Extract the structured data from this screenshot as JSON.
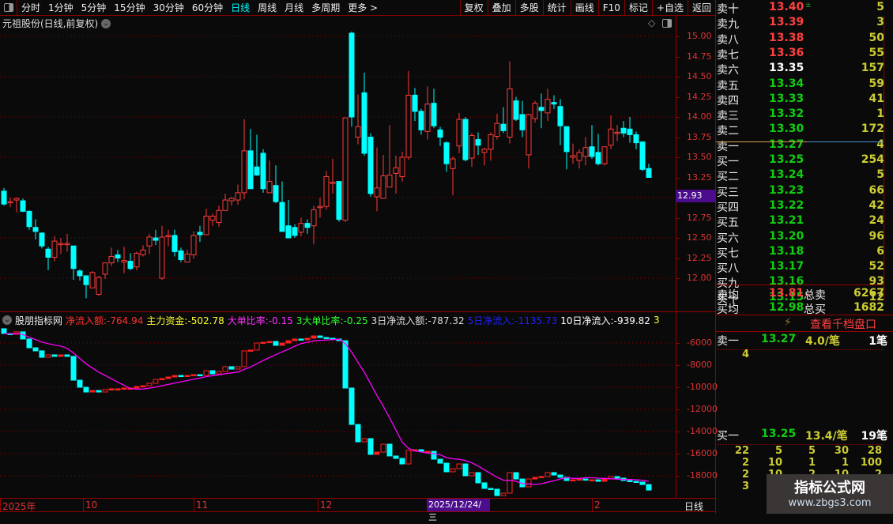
{
  "toolbar": {
    "periods": [
      "分时",
      "1分钟",
      "5分钟",
      "15分钟",
      "30分钟",
      "60分钟",
      "日线",
      "周线",
      "月线",
      "多周期",
      "更多 >"
    ],
    "active": "日线",
    "buttons": [
      "复权",
      "叠加",
      "多股",
      "统计",
      "画线",
      "F10",
      "标记",
      "+自选",
      "返回"
    ]
  },
  "stock_title": "元祖股份(日线,前复权)",
  "price_axis": {
    "labels": [
      "15.00",
      "14.75",
      "14.50",
      "14.25",
      "14.00",
      "13.75",
      "13.50",
      "13.25",
      "13.00",
      "12.75",
      "12.50",
      "12.25",
      "12.00"
    ],
    "cursor_price": "12.93"
  },
  "indicator": {
    "name": "股朋指标网",
    "items": [
      {
        "label": "净流入额:",
        "value": "-764.94",
        "color": "#ff3030"
      },
      {
        "label": "主力资金:",
        "value": "-502.78",
        "color": "#ffff30"
      },
      {
        "label": "大单比率:",
        "value": "-0.15",
        "color": "#ff30ff"
      },
      {
        "label": "3大单比率:",
        "value": "-0.25",
        "color": "#30ff30"
      },
      {
        "label": "3日净流入额:",
        "value": "-787.32",
        "color": "#dddddd"
      },
      {
        "label": "5日净流入:",
        "value": "-1135.73",
        "color": "#2020ff"
      },
      {
        "label": "10日净流入:",
        "value": "-939.82",
        "color": "#ffffff"
      },
      {
        "label": "3",
        "value": "",
        "color": "#ffff30"
      }
    ],
    "axis_labels": [
      "-6000",
      "-8000",
      "-10000",
      "-12000",
      "-14000",
      "-16000",
      "-18000"
    ]
  },
  "date_axis": {
    "labels": [
      "2025年",
      "10",
      "11",
      "12",
      "2"
    ],
    "cursor_date": "2025/12/24/三",
    "period": "日线"
  },
  "colors": {
    "up": "#ff3b3b",
    "down": "#00ffff",
    "ma": "#ff00ff",
    "grid": "#8b0000",
    "cursor": "#4b0d8c"
  },
  "chart_data": [
    {
      "type": "candlestick",
      "price_range": [
        11.75,
        15.1
      ],
      "ohlc": [
        [
          13.08,
          13.12,
          12.9,
          12.92
        ],
        [
          12.95,
          13.0,
          12.88,
          12.95
        ],
        [
          12.97,
          13.0,
          12.82,
          12.99
        ],
        [
          12.96,
          12.99,
          12.82,
          12.83
        ],
        [
          12.83,
          12.84,
          12.6,
          12.64
        ],
        [
          12.63,
          12.73,
          12.48,
          12.58
        ],
        [
          12.56,
          12.57,
          12.37,
          12.4
        ],
        [
          12.36,
          12.39,
          12.1,
          12.26
        ],
        [
          12.26,
          12.52,
          12.21,
          12.46
        ],
        [
          12.43,
          12.5,
          12.3,
          12.43
        ],
        [
          12.43,
          12.55,
          12.33,
          12.43
        ],
        [
          12.4,
          12.4,
          11.98,
          12.12
        ],
        [
          12.09,
          12.11,
          11.97,
          12.03
        ],
        [
          12.03,
          12.03,
          11.75,
          11.92
        ],
        [
          11.88,
          12.09,
          11.88,
          12.07
        ],
        [
          11.8,
          12.03,
          11.78,
          12.01
        ],
        [
          12.05,
          12.19,
          11.99,
          12.19
        ],
        [
          12.19,
          12.38,
          12.15,
          12.27
        ],
        [
          12.29,
          12.35,
          12.2,
          12.25
        ],
        [
          12.2,
          12.39,
          12.06,
          12.22
        ],
        [
          12.21,
          12.31,
          12.1,
          12.12
        ],
        [
          12.14,
          12.33,
          12.1,
          12.31
        ],
        [
          12.29,
          12.41,
          12.27,
          12.35
        ],
        [
          12.4,
          12.55,
          12.3,
          12.51
        ],
        [
          12.5,
          12.6,
          12.41,
          12.47
        ],
        [
          12.0,
          12.65,
          11.98,
          12.51
        ],
        [
          12.53,
          12.6,
          12.4,
          12.53
        ],
        [
          12.53,
          12.6,
          12.27,
          12.33
        ],
        [
          12.34,
          12.38,
          12.2,
          12.23
        ],
        [
          12.2,
          12.35,
          12.2,
          12.3
        ],
        [
          12.29,
          12.58,
          12.24,
          12.53
        ],
        [
          12.57,
          12.65,
          12.45,
          12.54
        ],
        [
          12.54,
          12.86,
          12.54,
          12.77
        ],
        [
          12.72,
          12.8,
          12.65,
          12.77
        ],
        [
          12.69,
          12.9,
          12.64,
          12.84
        ],
        [
          12.84,
          13.05,
          12.84,
          12.97
        ],
        [
          12.96,
          13.01,
          12.9,
          12.99
        ],
        [
          12.97,
          13.16,
          12.91,
          13.06
        ],
        [
          13.06,
          13.97,
          12.98,
          13.58
        ],
        [
          13.58,
          13.85,
          13.11,
          13.11
        ],
        [
          13.38,
          13.78,
          13.27,
          13.28
        ],
        [
          13.55,
          13.6,
          13.06,
          13.11
        ],
        [
          13.06,
          13.46,
          13.06,
          13.2
        ],
        [
          13.15,
          13.4,
          12.93,
          12.95
        ],
        [
          12.94,
          13.2,
          12.58,
          12.58
        ],
        [
          12.65,
          12.97,
          12.5,
          12.5
        ],
        [
          12.63,
          12.67,
          12.5,
          12.53
        ],
        [
          12.57,
          12.75,
          12.52,
          12.68
        ],
        [
          12.68,
          12.73,
          12.55,
          12.63
        ],
        [
          12.65,
          12.9,
          12.42,
          12.85
        ],
        [
          12.89,
          13.0,
          12.75,
          12.89
        ],
        [
          12.89,
          13.33,
          12.85,
          13.26
        ],
        [
          13.19,
          13.48,
          13.05,
          13.19
        ],
        [
          13.2,
          13.2,
          12.7,
          12.73
        ],
        [
          12.72,
          13.99,
          12.7,
          13.99
        ],
        [
          15.04,
          15.06,
          13.88,
          14.0
        ],
        [
          13.75,
          14.28,
          13.66,
          13.88
        ],
        [
          14.3,
          14.55,
          13.52,
          13.55
        ],
        [
          13.75,
          13.8,
          13.01,
          13.05
        ],
        [
          13.01,
          13.62,
          12.83,
          13.12
        ],
        [
          12.99,
          13.53,
          12.99,
          13.27
        ],
        [
          13.13,
          13.9,
          13.13,
          13.28
        ],
        [
          13.3,
          13.52,
          13.05,
          13.37
        ],
        [
          13.26,
          13.57,
          13.2,
          13.5
        ],
        [
          13.5,
          14.57,
          13.47,
          14.27
        ],
        [
          14.27,
          14.36,
          13.95,
          14.07
        ],
        [
          14.07,
          14.1,
          13.78,
          13.84
        ],
        [
          13.82,
          14.38,
          13.72,
          14.16
        ],
        [
          14.17,
          14.35,
          13.86,
          13.89
        ],
        [
          13.84,
          13.88,
          13.64,
          13.75
        ],
        [
          13.68,
          13.7,
          13.32,
          13.42
        ],
        [
          13.36,
          13.51,
          13.03,
          13.48
        ],
        [
          13.64,
          14.05,
          13.55,
          13.97
        ],
        [
          13.97,
          14.0,
          13.45,
          13.47
        ],
        [
          13.49,
          13.8,
          13.38,
          13.77
        ],
        [
          13.72,
          13.81,
          13.53,
          13.65
        ],
        [
          13.56,
          13.62,
          13.4,
          13.6
        ],
        [
          13.6,
          13.81,
          13.46,
          13.78
        ],
        [
          13.76,
          14.04,
          13.72,
          13.92
        ],
        [
          13.91,
          14.12,
          13.8,
          13.83
        ],
        [
          13.75,
          14.69,
          13.67,
          14.35
        ],
        [
          14.2,
          14.25,
          13.95,
          13.97
        ],
        [
          14.03,
          14.2,
          13.75,
          13.84
        ],
        [
          13.53,
          14.04,
          13.36,
          14.03
        ],
        [
          13.98,
          14.2,
          13.93,
          14.17
        ],
        [
          14.12,
          14.29,
          13.86,
          14.08
        ],
        [
          14.05,
          14.35,
          13.95,
          14.22
        ],
        [
          14.18,
          14.27,
          14.1,
          14.16
        ],
        [
          14.13,
          14.22,
          13.65,
          13.89
        ],
        [
          13.88,
          13.88,
          13.35,
          13.57
        ],
        [
          13.5,
          13.67,
          13.42,
          13.52
        ],
        [
          13.46,
          13.6,
          13.36,
          13.56
        ],
        [
          13.51,
          13.75,
          13.4,
          13.62
        ],
        [
          13.63,
          13.9,
          13.48,
          13.51
        ],
        [
          13.56,
          13.79,
          13.4,
          13.42
        ],
        [
          13.42,
          13.63,
          13.4,
          13.63
        ],
        [
          13.65,
          14.02,
          13.6,
          13.85
        ],
        [
          13.81,
          13.9,
          13.7,
          13.81
        ],
        [
          13.86,
          13.95,
          13.75,
          13.8
        ],
        [
          13.85,
          14.0,
          13.68,
          13.78
        ],
        [
          13.78,
          13.82,
          13.6,
          13.68
        ],
        [
          13.69,
          13.7,
          13.33,
          13.35
        ],
        [
          13.36,
          13.42,
          13.25,
          13.25
        ]
      ]
    },
    {
      "type": "candlestick-indicator",
      "start_value": -4710,
      "closes": [
        -5140,
        -5210,
        -4990,
        -5640,
        -6430,
        -6710,
        -7290,
        -7070,
        -7210,
        -7070,
        -7210,
        -9360,
        -10000,
        -10430,
        -10290,
        -10430,
        -10210,
        -10140,
        -10140,
        -10070,
        -10070,
        -9930,
        -9860,
        -9640,
        -9290,
        -9210,
        -9070,
        -8930,
        -9000,
        -8930,
        -8860,
        -8930,
        -8500,
        -8790,
        -8570,
        -8140,
        -8360,
        -8140,
        -6710,
        -6640,
        -6000,
        -5930,
        -5860,
        -6210,
        -6000,
        -5790,
        -5640,
        -5710,
        -5570,
        -5360,
        -5500,
        -5570,
        -5640,
        -5790,
        -10070,
        -13360,
        -14930,
        -14640,
        -16070,
        -15860,
        -15140,
        -16210,
        -16430,
        -16930,
        -15710,
        -15640,
        -15790,
        -15790,
        -16500,
        -16860,
        -17640,
        -17360,
        -16930,
        -18000,
        -17710,
        -18640,
        -19140,
        -19210,
        -19790,
        -19570,
        -17710,
        -18290,
        -19000,
        -18290,
        -18140,
        -18070,
        -17710,
        -17930,
        -18140,
        -18430,
        -18360,
        -18290,
        -18360,
        -18360,
        -18500,
        -18290,
        -18070,
        -18210,
        -18430,
        -18500,
        -18570,
        -18790,
        -19290
      ],
      "ma_period": 10,
      "value_range": [
        -20000,
        -4500
      ]
    }
  ],
  "orderbook": {
    "asks": [
      {
        "n": "卖十",
        "p": "13.40",
        "v": "5",
        "c": "red",
        "mark": "±"
      },
      {
        "n": "卖九",
        "p": "13.39",
        "v": "3",
        "c": "red"
      },
      {
        "n": "卖八",
        "p": "13.38",
        "v": "50",
        "c": "red"
      },
      {
        "n": "卖七",
        "p": "13.36",
        "v": "55",
        "c": "red"
      },
      {
        "n": "卖六",
        "p": "13.35",
        "v": "157",
        "c": "wht"
      },
      {
        "n": "卖五",
        "p": "13.34",
        "v": "59",
        "c": "grn"
      },
      {
        "n": "卖四",
        "p": "13.33",
        "v": "41",
        "c": "grn"
      },
      {
        "n": "卖三",
        "p": "13.32",
        "v": "1",
        "c": "grn"
      },
      {
        "n": "卖二",
        "p": "13.30",
        "v": "172",
        "c": "grn"
      },
      {
        "n": "卖一",
        "p": "13.27",
        "v": "4",
        "c": "grn"
      }
    ],
    "bids": [
      {
        "n": "买一",
        "p": "13.25",
        "v": "254",
        "c": "grn"
      },
      {
        "n": "买二",
        "p": "13.24",
        "v": "5",
        "c": "grn"
      },
      {
        "n": "买三",
        "p": "13.23",
        "v": "66",
        "c": "grn"
      },
      {
        "n": "买四",
        "p": "13.22",
        "v": "42",
        "c": "grn"
      },
      {
        "n": "买五",
        "p": "13.21",
        "v": "24",
        "c": "grn"
      },
      {
        "n": "买六",
        "p": "13.20",
        "v": "96",
        "c": "grn"
      },
      {
        "n": "买七",
        "p": "13.18",
        "v": "6",
        "c": "grn"
      },
      {
        "n": "买八",
        "p": "13.17",
        "v": "52",
        "c": "grn"
      },
      {
        "n": "买九",
        "p": "13.16",
        "v": "93",
        "c": "grn"
      },
      {
        "n": "买十",
        "p": "13.15",
        "v": "12",
        "c": "grn",
        "mark": "▾"
      }
    ],
    "avg_sell": {
      "label": "卖均",
      "price": "13.81",
      "total_label": "总卖",
      "total": "6267"
    },
    "avg_buy": {
      "label": "买均",
      "price": "12.98",
      "total_label": "总买",
      "total": "1682"
    },
    "kilo_link": "查看千档盘口",
    "ask1_detail": {
      "label": "卖一",
      "price": "13.27",
      "per": "4.0/笔",
      "count": "1笔",
      "orders": [
        "4"
      ]
    },
    "bid1_detail": {
      "label": "买一",
      "price": "13.25",
      "per": "13.4/笔",
      "count": "19笔",
      "orders": [
        [
          "22",
          "5",
          "5",
          "30",
          "28"
        ],
        [
          "2",
          "10",
          "1",
          "1",
          "100"
        ],
        [
          "2",
          "10",
          "2",
          "10",
          "2"
        ],
        [
          "3"
        ]
      ]
    }
  },
  "watermark": {
    "title": "指标公式网",
    "url": "www.zbgs3.com"
  }
}
